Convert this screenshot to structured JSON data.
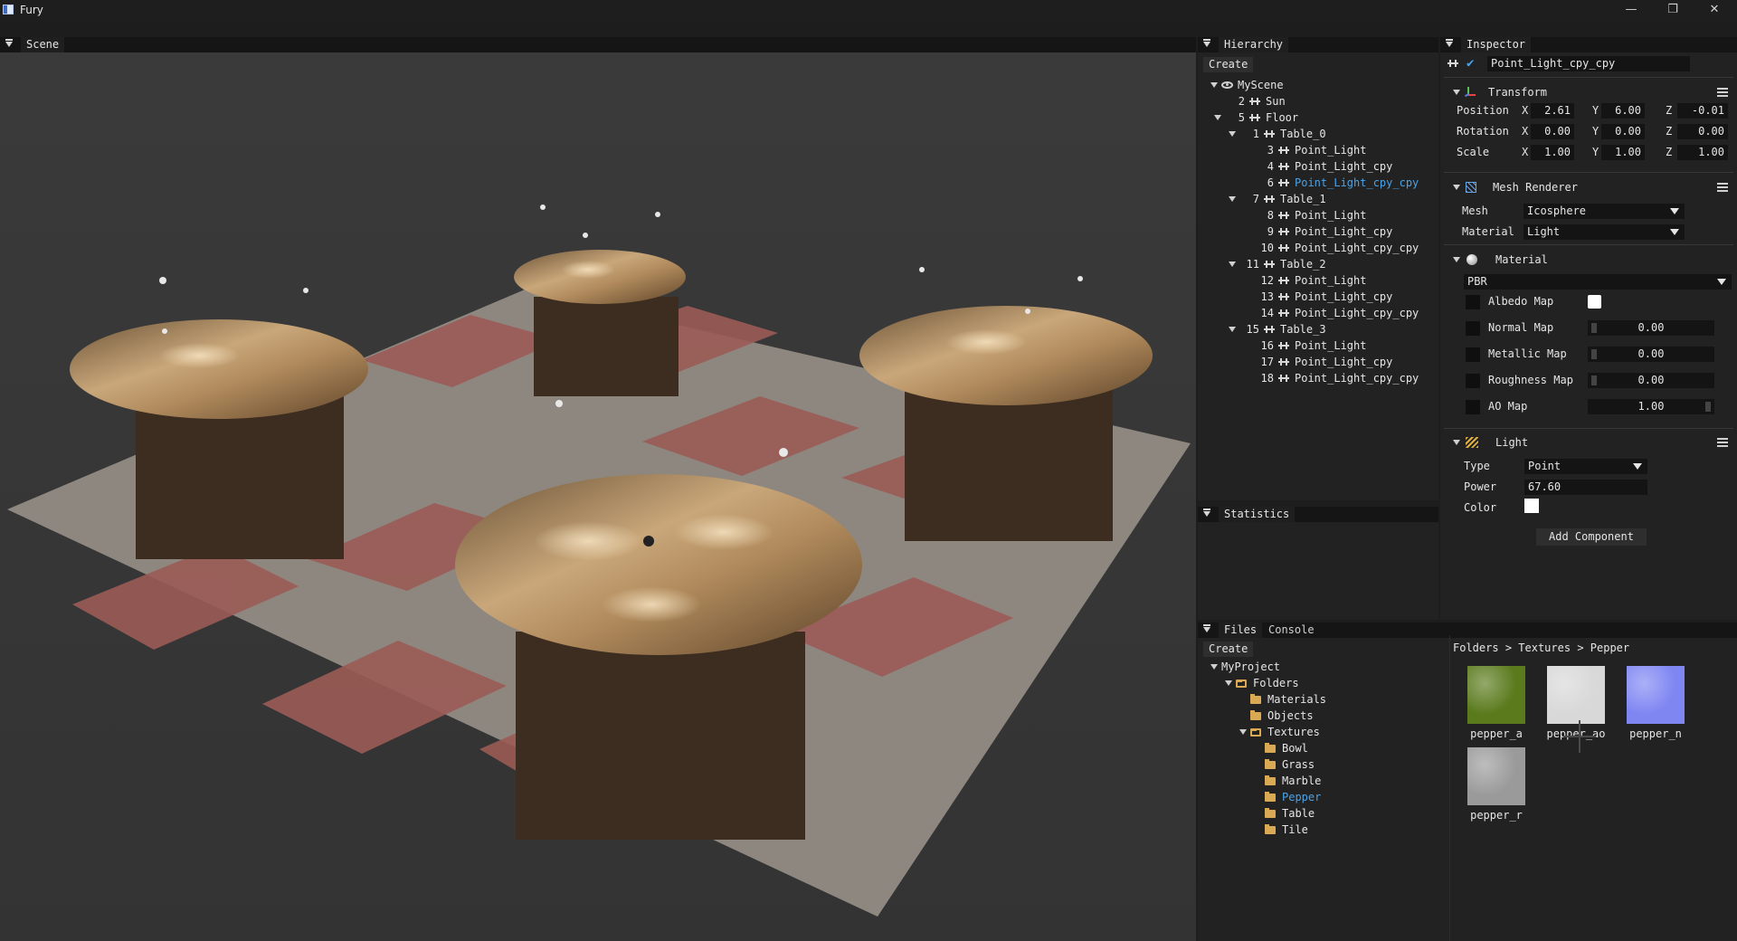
{
  "window": {
    "title": "Fury",
    "controls": [
      "—",
      "❐",
      "✕"
    ]
  },
  "scene": {
    "tab": "Scene"
  },
  "hierarchy": {
    "tab": "Hierarchy",
    "create_label": "Create",
    "root": "MyScene",
    "items": [
      {
        "num": "2",
        "label": "Sun",
        "depth": 1,
        "caret": false
      },
      {
        "num": "5",
        "label": "Floor",
        "depth": 1,
        "caret": true
      },
      {
        "num": "1",
        "label": "Table_0",
        "depth": 2,
        "caret": true
      },
      {
        "num": "3",
        "label": "Point_Light",
        "depth": 3,
        "caret": false
      },
      {
        "num": "4",
        "label": "Point_Light_cpy",
        "depth": 3,
        "caret": false
      },
      {
        "num": "6",
        "label": "Point_Light_cpy_cpy",
        "depth": 3,
        "caret": false,
        "selected": true
      },
      {
        "num": "7",
        "label": "Table_1",
        "depth": 2,
        "caret": true
      },
      {
        "num": "8",
        "label": "Point_Light",
        "depth": 3,
        "caret": false
      },
      {
        "num": "9",
        "label": "Point_Light_cpy",
        "depth": 3,
        "caret": false
      },
      {
        "num": "10",
        "label": "Point_Light_cpy_cpy",
        "depth": 3,
        "caret": false
      },
      {
        "num": "11",
        "label": "Table_2",
        "depth": 2,
        "caret": true
      },
      {
        "num": "12",
        "label": "Point_Light",
        "depth": 3,
        "caret": false
      },
      {
        "num": "13",
        "label": "Point_Light_cpy",
        "depth": 3,
        "caret": false
      },
      {
        "num": "14",
        "label": "Point_Light_cpy_cpy",
        "depth": 3,
        "caret": false
      },
      {
        "num": "15",
        "label": "Table_3",
        "depth": 2,
        "caret": true
      },
      {
        "num": "16",
        "label": "Point_Light",
        "depth": 3,
        "caret": false
      },
      {
        "num": "17",
        "label": "Point_Light_cpy",
        "depth": 3,
        "caret": false
      },
      {
        "num": "18",
        "label": "Point_Light_cpy_cpy",
        "depth": 3,
        "caret": false
      }
    ]
  },
  "statistics": {
    "tab": "Statistics"
  },
  "inspector": {
    "tab": "Inspector",
    "object_name": "Point_Light_cpy_cpy",
    "transform": {
      "title": "Transform",
      "rows": [
        {
          "label": "Position",
          "x": "2.61",
          "y": "6.00",
          "z": "-0.01"
        },
        {
          "label": "Rotation",
          "x": "0.00",
          "y": "0.00",
          "z": "0.00"
        },
        {
          "label": "Scale",
          "x": "1.00",
          "y": "1.00",
          "z": "1.00"
        }
      ],
      "axis_x": "X",
      "axis_y": "Y",
      "axis_z": "Z"
    },
    "mesh_renderer": {
      "title": "Mesh Renderer",
      "mesh_label": "Mesh",
      "mesh_value": "Icosphere",
      "material_label": "Material",
      "material_value": "Light"
    },
    "material": {
      "title": "Material",
      "shader": "PBR",
      "maps": [
        {
          "label": "Albedo Map",
          "value": ""
        },
        {
          "label": "Normal Map",
          "value": "0.00"
        },
        {
          "label": "Metallic Map",
          "value": "0.00"
        },
        {
          "label": "Roughness Map",
          "value": "0.00"
        },
        {
          "label": "AO Map",
          "value": "1.00"
        }
      ]
    },
    "light": {
      "title": "Light",
      "type_label": "Type",
      "type_value": "Point",
      "power_label": "Power",
      "power_value": "67.60",
      "color_label": "Color"
    },
    "add_component_label": "Add Component"
  },
  "files": {
    "tab_files": "Files",
    "tab_console": "Console",
    "create_label": "Create",
    "breadcrumb": [
      "Folders",
      "Textures",
      "Pepper"
    ],
    "breadcrumb_sep": ">",
    "tree": [
      {
        "label": "MyProject",
        "depth": 0,
        "caret": true,
        "icon": "none"
      },
      {
        "label": "Folders",
        "depth": 1,
        "caret": true,
        "icon": "open"
      },
      {
        "label": "Materials",
        "depth": 2,
        "caret": false,
        "icon": "closed"
      },
      {
        "label": "Objects",
        "depth": 2,
        "caret": false,
        "icon": "closed"
      },
      {
        "label": "Textures",
        "depth": 2,
        "caret": true,
        "icon": "open"
      },
      {
        "label": "Bowl",
        "depth": 3,
        "caret": false,
        "icon": "closed"
      },
      {
        "label": "Grass",
        "depth": 3,
        "caret": false,
        "icon": "closed"
      },
      {
        "label": "Marble",
        "depth": 3,
        "caret": false,
        "icon": "closed"
      },
      {
        "label": "Pepper",
        "depth": 3,
        "caret": false,
        "icon": "closed",
        "selected": true
      },
      {
        "label": "Table",
        "depth": 3,
        "caret": false,
        "icon": "closed"
      },
      {
        "label": "Tile",
        "depth": 3,
        "caret": false,
        "icon": "closed"
      }
    ],
    "thumbnails": [
      {
        "label": "pepper_a",
        "color": "#5a7a1c"
      },
      {
        "label": "pepper_ao",
        "color": "#d8d8d8"
      },
      {
        "label": "pepper_n",
        "color": "#7f86f2"
      },
      {
        "label": "pepper_r",
        "color": "#9a9a9a"
      }
    ],
    "add_icon": "plus-icon"
  },
  "colors": {
    "accent_selected": "#4aa3e8",
    "check": "#4aa3e8",
    "folder": "#d9a954"
  }
}
